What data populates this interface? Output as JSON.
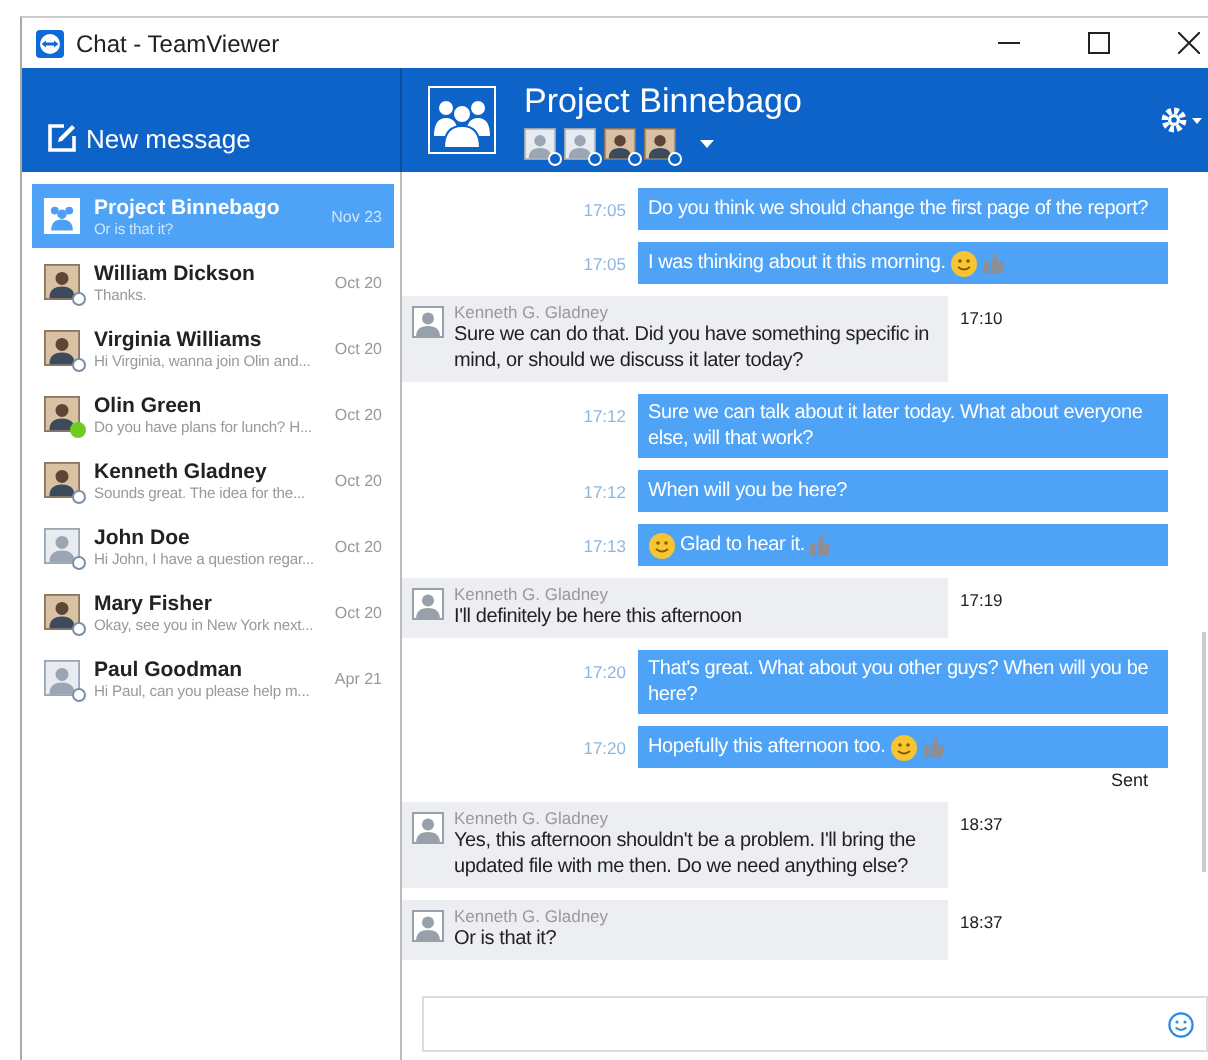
{
  "window": {
    "title": "Chat - TeamViewer"
  },
  "new_message": {
    "label": "New message"
  },
  "conversation": {
    "title": "Project Binnebago",
    "participants": [
      {
        "photo": false,
        "online": false
      },
      {
        "photo": false,
        "online": false
      },
      {
        "photo": true,
        "online": false
      },
      {
        "photo": true,
        "online": false
      }
    ]
  },
  "contacts": [
    {
      "kind": "group",
      "name": "Project Binnebago",
      "preview": "Or is that it?",
      "date": "Nov 23",
      "selected": true
    },
    {
      "kind": "person",
      "photo": true,
      "name": "William Dickson",
      "preview": "Thanks.",
      "date": "Oct 20",
      "selected": false,
      "online": false
    },
    {
      "kind": "person",
      "photo": true,
      "name": "Virginia Williams",
      "preview": "Hi Virginia, wanna join Olin and...",
      "date": "Oct 20",
      "selected": false,
      "online": false
    },
    {
      "kind": "person",
      "photo": true,
      "name": "Olin Green",
      "preview": "Do you have plans for lunch? H...",
      "date": "Oct 20",
      "selected": false,
      "online": true
    },
    {
      "kind": "person",
      "photo": true,
      "name": "Kenneth Gladney",
      "preview": "Sounds great. The idea for the...",
      "date": "Oct 20",
      "selected": false,
      "online": false
    },
    {
      "kind": "person",
      "photo": false,
      "name": "John Doe",
      "preview": "Hi John, I have a question regar...",
      "date": "Oct 20",
      "selected": false,
      "online": false
    },
    {
      "kind": "person",
      "photo": true,
      "name": "Mary Fisher",
      "preview": "Okay, see you in New York next...",
      "date": "Oct 20",
      "selected": false,
      "online": false
    },
    {
      "kind": "person",
      "photo": false,
      "name": "Paul Goodman",
      "preview": "Hi Paul, can you please help m...",
      "date": "Apr 21",
      "selected": false,
      "online": false
    }
  ],
  "messages": [
    {
      "kind": "outgoing",
      "time": "17:05",
      "text": "Do you think we should change the first page of the report?"
    },
    {
      "kind": "outgoing",
      "time": "17:05",
      "text": "I was thinking about it this morning.",
      "emoji_after": [
        {
          "kind": "smiley"
        },
        {
          "kind": "thumbs-up"
        }
      ]
    },
    {
      "kind": "incoming",
      "sender": "Kenneth G. Gladney",
      "time": "17:10",
      "text": "Sure we can do that. Did you have something specific in mind, or should we discuss it later today?"
    },
    {
      "kind": "outgoing",
      "time": "17:12",
      "text": "Sure we can talk about it later today. What about everyone else, will that work?"
    },
    {
      "kind": "outgoing",
      "time": "17:12",
      "text": "When will you be here?"
    },
    {
      "kind": "outgoing",
      "time": "17:13",
      "text": "Glad to hear it.",
      "emoji_before": [
        {
          "kind": "smiley"
        }
      ],
      "emoji_after": [
        {
          "kind": "thumbs-up"
        }
      ]
    },
    {
      "kind": "incoming",
      "sender": "Kenneth G. Gladney",
      "time": "17:19",
      "text": "I'll definitely be here this afternoon"
    },
    {
      "kind": "outgoing",
      "time": "17:20",
      "text": "That's great. What about you other guys? When will you be here?"
    },
    {
      "kind": "outgoing",
      "time": "17:20",
      "text": "Hopefully this afternoon too.",
      "emoji_after": [
        {
          "kind": "smiley"
        },
        {
          "kind": "thumbs-up"
        }
      ],
      "status": "Sent"
    },
    {
      "kind": "incoming",
      "sender": "Kenneth G. Gladney",
      "time": "18:37",
      "text": "Yes, this afternoon shouldn't be a problem. I'll bring the updated file with me then. Do we need anything else?"
    },
    {
      "kind": "incoming",
      "sender": "Kenneth G. Gladney",
      "time": "18:37",
      "text": "Or is that it?"
    }
  ]
}
